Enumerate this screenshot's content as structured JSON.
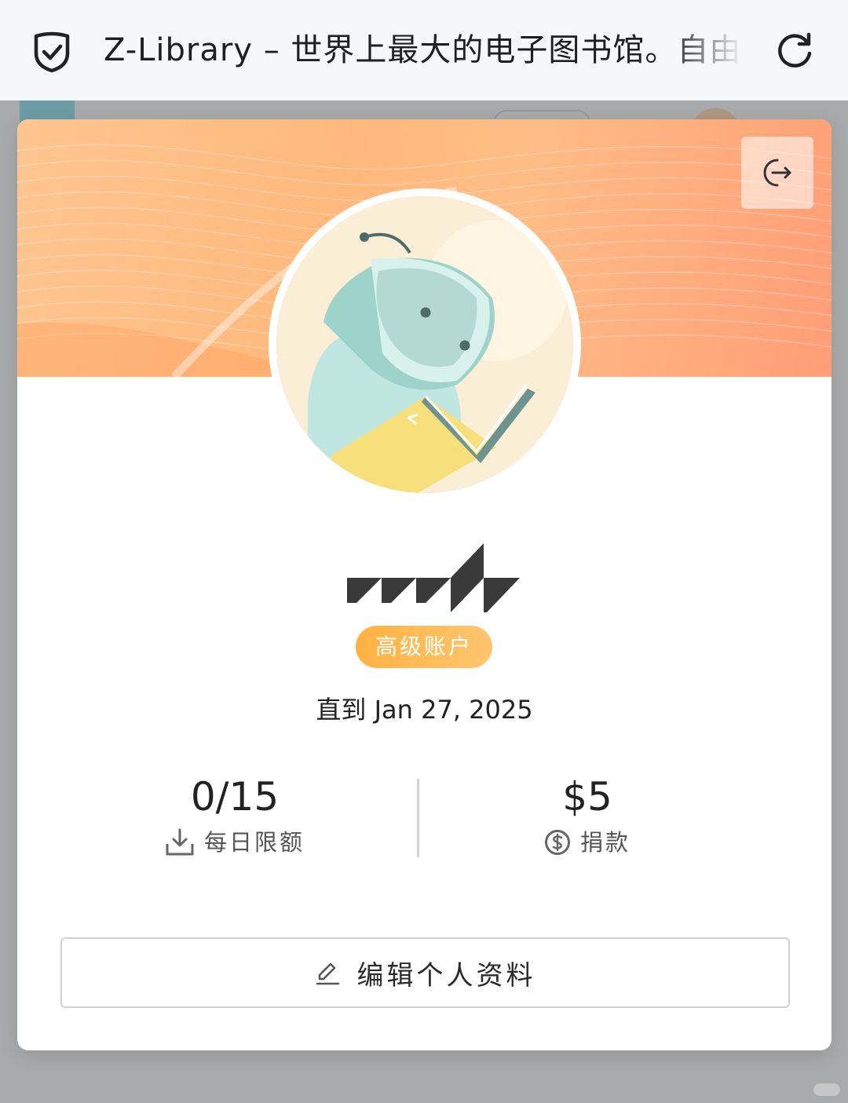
{
  "browser": {
    "title": "Z-Library – 世界上最大的电子图书馆。自由",
    "shield_icon": "shield-check-icon",
    "reload_icon": "reload-icon"
  },
  "profile": {
    "logout_icon": "logout-icon",
    "avatar_icon": "robot-reading-book-avatar",
    "account_badge": "高级账户",
    "valid_until": "直到 Jan 27, 2025",
    "daily_limit": {
      "value": "0/15",
      "label": "每日限额",
      "icon": "download-icon"
    },
    "donation": {
      "value": "$5",
      "label": "捐款",
      "icon": "dollar-circle-icon"
    },
    "edit_button": {
      "label": "编辑个人资料",
      "icon": "pencil-icon"
    }
  },
  "colors": {
    "banner_start": "#ffc590",
    "banner_end": "#ff9d77",
    "badge": "#ffb13f",
    "avatar_ring": "#f7b98f"
  }
}
